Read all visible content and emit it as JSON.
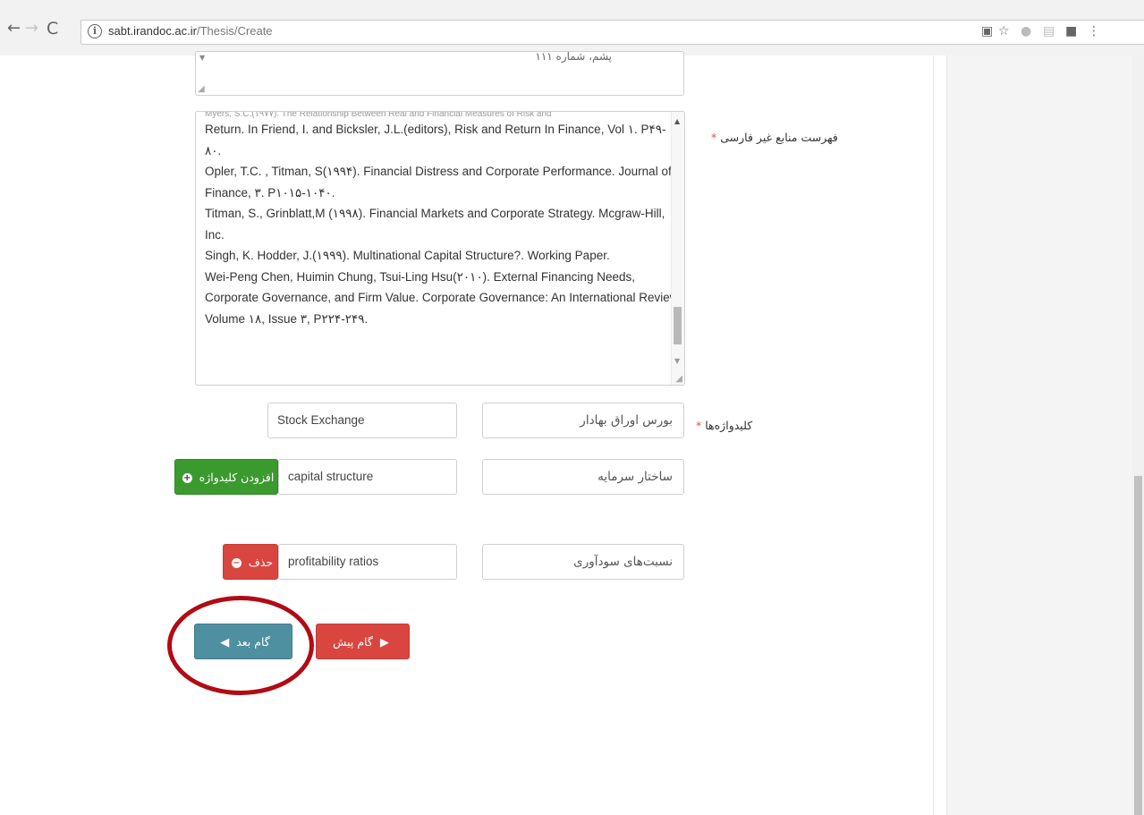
{
  "browser": {
    "url_domain": "sabt.irandoc.ac.ir",
    "url_path": "/Thesis/Create"
  },
  "form": {
    "top_fragment": "پشم، شماره ۱۱۱",
    "refs_label": "فهرست منابع غیر فارسی",
    "required_mark": "*",
    "refs_text": [
      "Return. In Friend, I. and Bicksler, J.L.(editors), Risk and Return In Finance, Vol ۱. P۴۹-",
      "۸۰.",
      "Opler, T.C. , Titman, S(۱۹۹۴). Financial Distress and Corporate Performance. Journal of",
      "Finance, ۳. P۱۰۱۵-۱۰۴۰.",
      "Titman, S., Grinblatt,M (۱۹۹۸). Financial Markets and Corporate Strategy. Mcgraw-Hill,",
      "Inc.",
      "Singh, K. Hodder, J.(۱۹۹۹). Multinational Capital Structure?. Working Paper.",
      "Wei-Peng Chen, Huimin Chung, Tsui-Ling Hsu(۲۰۱۰). External Financing Needs,",
      "Corporate Governance, and Firm Value. Corporate Governance: An International Review,",
      "Volume ۱۸, Issue ۳, P۲۲۴-۲۴۹."
    ],
    "keywords_label": "کلیدواژه‌ها",
    "keywords": [
      {
        "fa": "بورس اوراق بهادار",
        "en": "Stock Exchange"
      },
      {
        "fa": "ساختار سرمایه",
        "en": "capital structure"
      },
      {
        "fa": "نسبت‌های سودآوری",
        "en": "profitability ratios"
      }
    ],
    "add_keyword_label": "افزودن کلیدواژه",
    "delete_label": "حذف",
    "next_label": "گام بعد",
    "prev_label": "گام پیش"
  }
}
